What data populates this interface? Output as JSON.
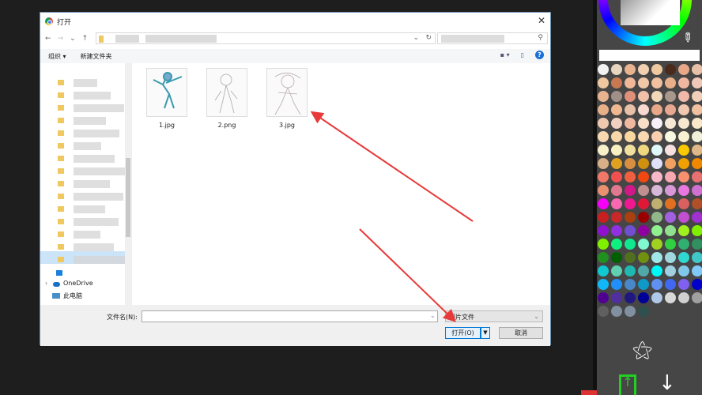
{
  "dialog": {
    "title": "打开",
    "close": "✕",
    "nav": {
      "back": "←",
      "forward": "→",
      "recent": "⌄",
      "up": "↑",
      "refresh": "↻",
      "dropdown": "⌄",
      "search_icon": "⚲"
    },
    "toolbar": {
      "organize": "组织 ▾",
      "new_folder": "新建文件夹",
      "view": "▪ ▾",
      "pane": "▯",
      "help": "?"
    },
    "sidebar": {
      "onedrive": "OneDrive",
      "this_pc": "此电脑"
    },
    "files": [
      {
        "name": "1.jpg"
      },
      {
        "name": "2.png"
      },
      {
        "name": "3.jpg"
      }
    ],
    "filename_label": "文件名(N):",
    "filename_value": "",
    "filetype": "图片文件",
    "open_button": "打开(O)",
    "cancel_button": "取消"
  },
  "palette": {
    "colors": [
      "#f2f2f2",
      "#e8d5c0",
      "#e8b490",
      "#f0d0b0",
      "#f0c8a0",
      "#4a2a1a",
      "#e8a888",
      "#e8c0a8",
      "#f0c8a0",
      "#c87850",
      "#f0b898",
      "#f0c8a8",
      "#f0c0a0",
      "#e8b088",
      "#f0b8a0",
      "#f0c8b8",
      "#e8b490",
      "#a09088",
      "#e0907a",
      "#f0c0a8",
      "#f0d8b8",
      "#a8988c",
      "#f0b8a8",
      "#f0d0b8",
      "#e8b088",
      "#f0b890",
      "#e8c0a8",
      "#f8d8d0",
      "#e8a888",
      "#e8a890",
      "#f0c8b0",
      "#f0c0a0",
      "#f0c8b0",
      "#f0d0c0",
      "#f0b8a0",
      "#f8e0c8",
      "#f8f0f8",
      "#f8e8d8",
      "#f8e8d0",
      "#f8e8c8",
      "#f8d8b0",
      "#f8d8a8",
      "#f8d8a0",
      "#f8d8b0",
      "#f8d0b0",
      "#f8f8e0",
      "#f8f0d0",
      "#f0f0d8",
      "#f8f0c8",
      "#f8f0c0",
      "#f0e0a0",
      "#f0d880",
      "#e0f8f8",
      "#f8e0e0",
      "#f8c800",
      "#e0b888",
      "#d8b088",
      "#e0a020",
      "#d89040",
      "#d09010",
      "#e0e0f8",
      "#f0a060",
      "#f0a000",
      "#f08800",
      "#f07868",
      "#f05050",
      "#f06040",
      "#f04810",
      "#f8b8c8",
      "#f8a8b0",
      "#f89070",
      "#e87070",
      "#e89070",
      "#e07890",
      "#d01888",
      "#c09090",
      "#d8b8d8",
      "#d898d8",
      "#e878e0",
      "#d070d0",
      "#f800f8",
      "#f868b0",
      "#f01890",
      "#e01838",
      "#c0b070",
      "#e07020",
      "#d86060",
      "#b05028",
      "#c82020",
      "#c82828",
      "#a84010",
      "#980000",
      "#90b888",
      "#a060e0",
      "#c050d0",
      "#a030d0",
      "#9010d0",
      "#9030e0",
      "#7050d0",
      "#9000a0",
      "#90f090",
      "#90e090",
      "#a0f020",
      "#80f000",
      "#80f000",
      "#10f080",
      "#10e890",
      "#80f8d0",
      "#a0d020",
      "#30d040",
      "#30b070",
      "#309060",
      "#209020",
      "#006000",
      "#507020",
      "#709010",
      "#a0e8e8",
      "#a0d8e0",
      "#30d8d0",
      "#40c8c8",
      "#10c8d0",
      "#60d0b0",
      "#20b8b0",
      "#50a8a8",
      "#00f8f8",
      "#a0d0e0",
      "#80c8e8",
      "#80c8f8",
      "#10b8f8",
      "#2090f8",
      "#4888c8",
      "#1098c8",
      "#6090f0",
      "#4068f0",
      "#8060f0",
      "#0000c8",
      "#500090",
      "#5030a0",
      "#201880",
      "#000098",
      "#b0c8e8",
      "#d8d8d8",
      "#d0d0d0",
      "#a0a0a0",
      "#606060",
      "#8090a0",
      "#8090a0",
      "#305050"
    ],
    "tools": {
      "magic": "magic-wand",
      "upload": "upload",
      "download": "download"
    }
  }
}
